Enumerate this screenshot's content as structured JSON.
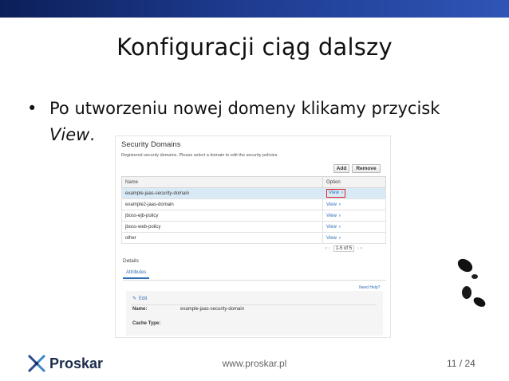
{
  "slide": {
    "title": "Konfiguracji ciąg dalszy",
    "bullet_symbol": "•",
    "bullet_line1": "Po utworzeniu nowej domeny klikamy przycisk",
    "bullet_line2_emph": "View",
    "bullet_line2_tail": "."
  },
  "console": {
    "title": "Security Domains",
    "subtitle": "Registered security domains. Please select a domain to edit the security policies.",
    "add_label": "Add",
    "remove_label": "Remove",
    "columns": [
      "Name",
      "Option"
    ],
    "rows": [
      {
        "name": "example-jaas-security-domain",
        "option": "View"
      },
      {
        "name": "example2-jaas-domain",
        "option": "View"
      },
      {
        "name": "jboss-ejb-policy",
        "option": "View"
      },
      {
        "name": "jboss-web-policy",
        "option": "View"
      },
      {
        "name": "other",
        "option": "View"
      }
    ],
    "pager": {
      "first": "«",
      "prev": "‹",
      "range": "1-5 of 5",
      "next": "›",
      "last": "»"
    },
    "details_label": "Details",
    "tab_attributes": "Attributes",
    "need_help": "Need Help?",
    "edit_label": "Edit",
    "name_label": "Name:",
    "name_value": "example-jaas-security-domain",
    "cache_label": "Cache Type:",
    "cache_value": ""
  },
  "footer": {
    "brand": "Proskar",
    "url": "www.proskar.pl",
    "page": "11 / 24"
  },
  "colors": {
    "topbar_start": "#0c1f58",
    "topbar_end": "#2f55b6",
    "link": "#2f6fb5",
    "selected_row": "#d9eaf7",
    "highlight": "#e02020"
  }
}
